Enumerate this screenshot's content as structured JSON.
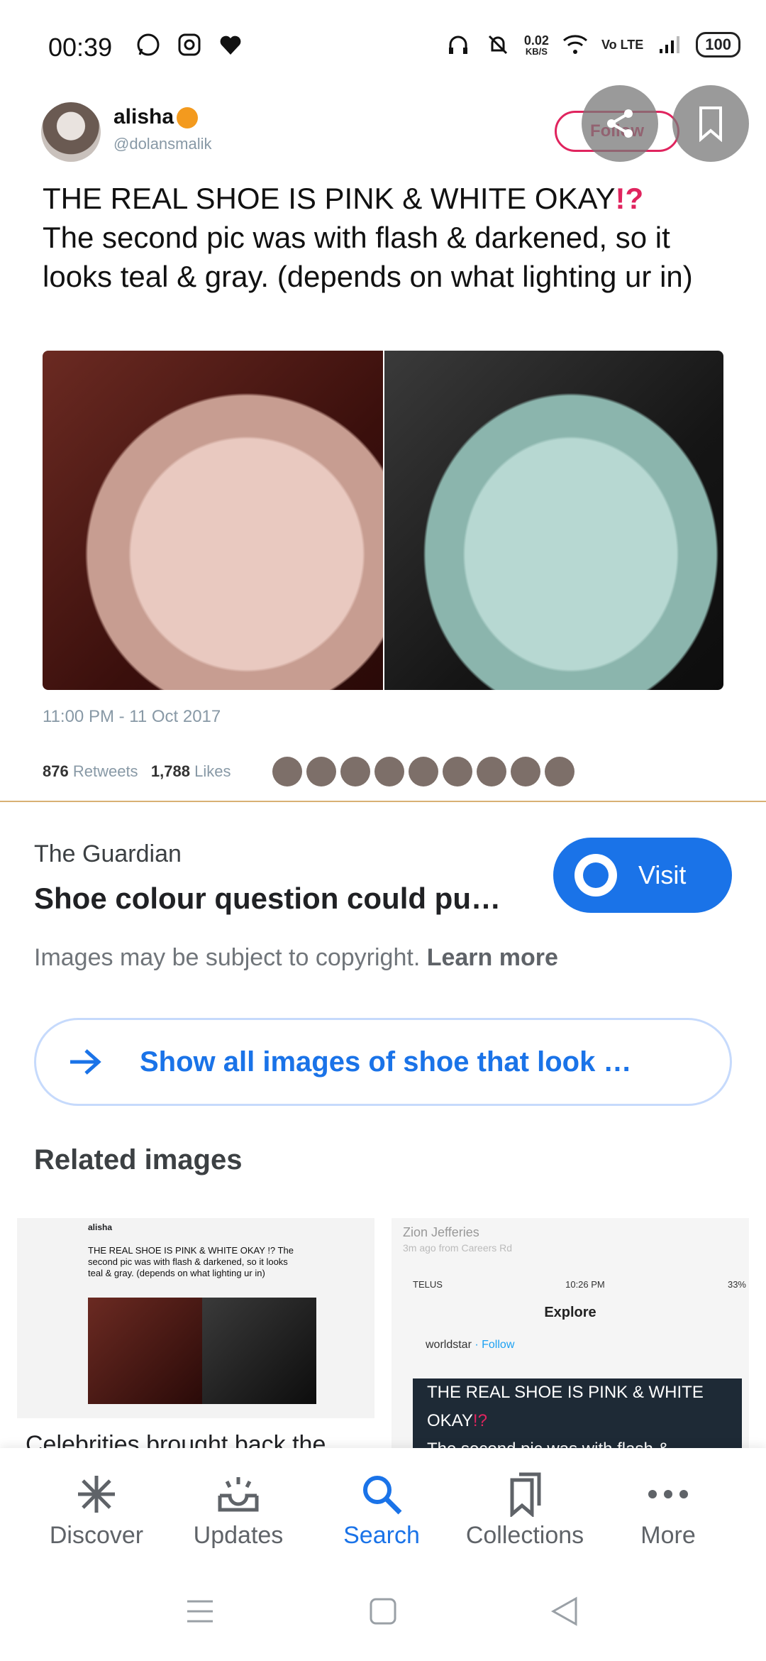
{
  "status_bar": {
    "time": "00:39",
    "net_speed_value": "0.02",
    "net_speed_unit": "KB/S",
    "volte": "Vo LTE",
    "battery": "100"
  },
  "tweet": {
    "name": "alisha",
    "handle": "@dolansmalik",
    "follow_label": "Follow",
    "text": "THE REAL SHOE IS PINK & WHITE OKAY",
    "text_qm": "!?",
    "text_2": "The second pic was with flash & darkened, so it looks teal & gray. (depends on what lighting ur in)",
    "date": "11:00 PM - 11 Oct 2017",
    "retweets_count": "876",
    "retweets_label": "Retweets",
    "likes_count": "1,788",
    "likes_label": "Likes"
  },
  "result": {
    "source": "The Guardian",
    "headline": "Shoe colour question could put…",
    "visit_label": "Visit",
    "copyright_text": "Images may be subject to copyright.",
    "learn_more": "Learn more",
    "show_all_label": "Show all images of shoe that look …"
  },
  "related": {
    "title": "Related images",
    "items": [
      {
        "caption": "Celebrities brought back the",
        "thumb_name": "alisha",
        "thumb_text": "THE REAL SHOE IS PINK & WHITE OKAY !? The second pic was with flash & darkened, so it looks teal & gray. (depends on what lighting ur in)"
      },
      {
        "z_name": "Zion Jefferies",
        "z_sub": "3m ago from Careers Rd",
        "carrier": "TELUS",
        "clock": "10:26 PM",
        "battery": "33%",
        "explore": "Explore",
        "account": "worldstar",
        "account_follow": "· Follow",
        "dark_text": "THE REAL SHOE IS PINK & WHITE OKAY",
        "dark_qm": "!?",
        "dark_text_2": "The second pic was with flash &"
      }
    ]
  },
  "bottom_nav": {
    "items": [
      {
        "label": "Discover",
        "icon": "asterisk-icon"
      },
      {
        "label": "Updates",
        "icon": "inbox-icon"
      },
      {
        "label": "Search",
        "icon": "search-icon"
      },
      {
        "label": "Collections",
        "icon": "bookmarks-icon"
      },
      {
        "label": "More",
        "icon": "more-icon"
      }
    ],
    "active": "Search"
  },
  "colors": {
    "accent": "#1a73e8",
    "twitter_pink": "#e0245e"
  }
}
